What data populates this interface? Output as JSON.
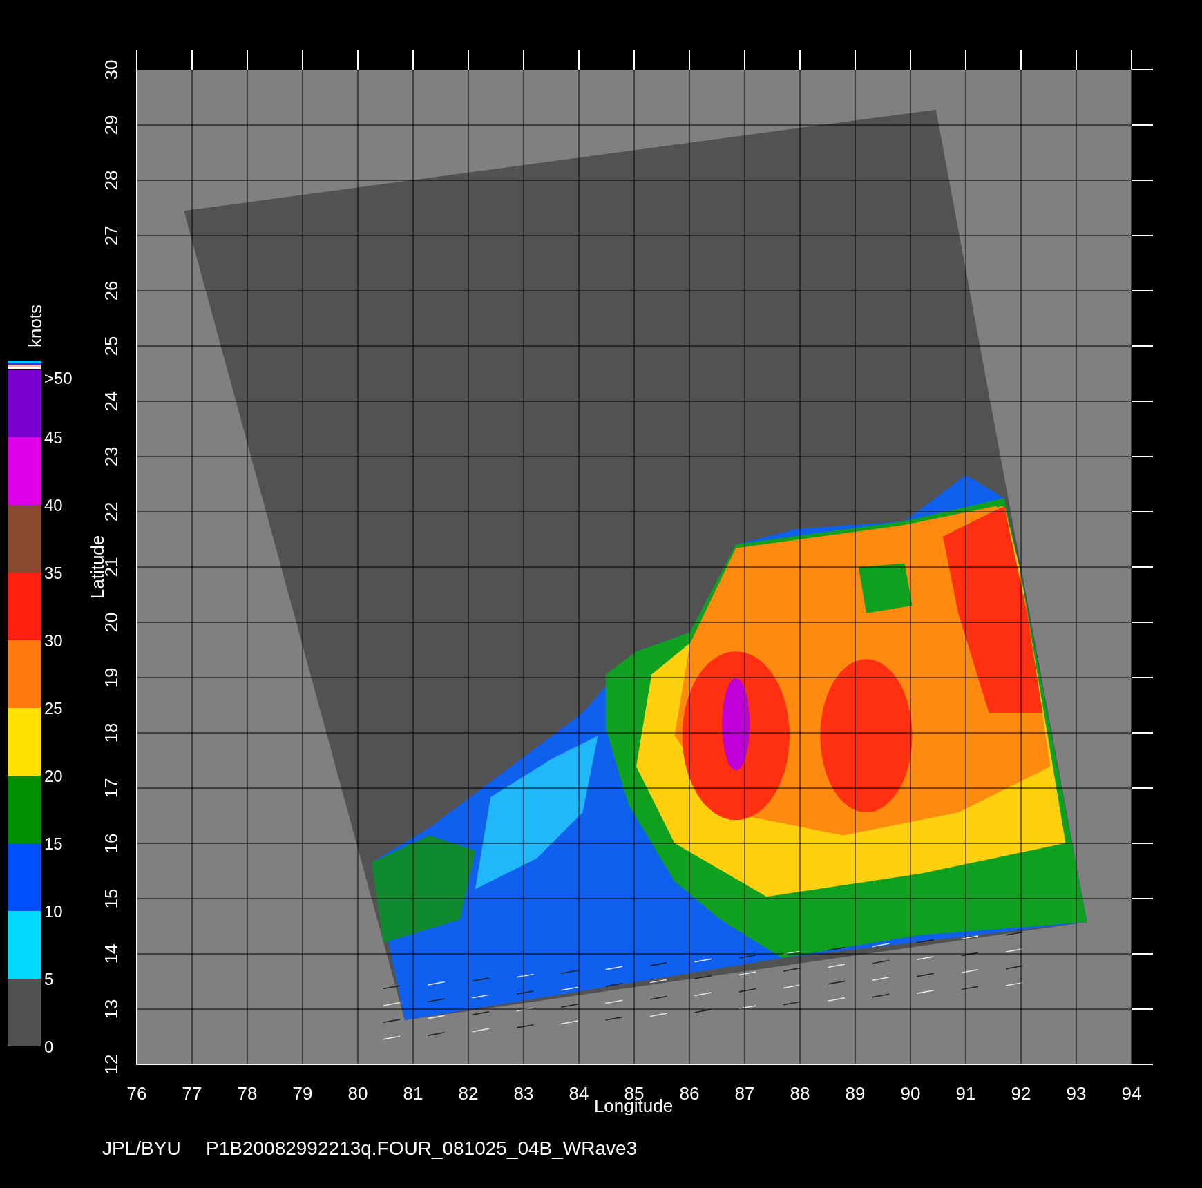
{
  "map": {
    "x_axis": {
      "title": "Longitude",
      "tick_labels": [
        "76",
        "77",
        "78",
        "79",
        "80",
        "81",
        "82",
        "83",
        "84",
        "85",
        "86",
        "87",
        "88",
        "89",
        "90",
        "91",
        "92",
        "93",
        "94"
      ]
    },
    "y_axis": {
      "title": "Latitude",
      "tick_labels": [
        "12",
        "13",
        "14",
        "15",
        "16",
        "17",
        "18",
        "19",
        "20",
        "21",
        "22",
        "23",
        "24",
        "25",
        "26",
        "27",
        "28",
        "29",
        "30"
      ]
    }
  },
  "colorbar": {
    "unit": "knots",
    "bands": [
      {
        "color": "#7a00d0"
      },
      {
        "color": "#e000e8"
      },
      {
        "color": "#8a4a30"
      },
      {
        "color": "#ff2010"
      },
      {
        "color": "#ff7a10"
      },
      {
        "color": "#ffe000"
      },
      {
        "color": "#009000"
      },
      {
        "color": "#0050ff"
      },
      {
        "color": "#00d8ff"
      },
      {
        "color": "#505050"
      }
    ],
    "labels": [
      ">50",
      "45",
      "40",
      "35",
      "30",
      "25",
      "20",
      "15",
      "10",
      "5",
      "0"
    ]
  },
  "caption": {
    "source": "JPL/BYU",
    "file": "P1B20082992213q.FOUR_081025_04B_WRave3"
  }
}
